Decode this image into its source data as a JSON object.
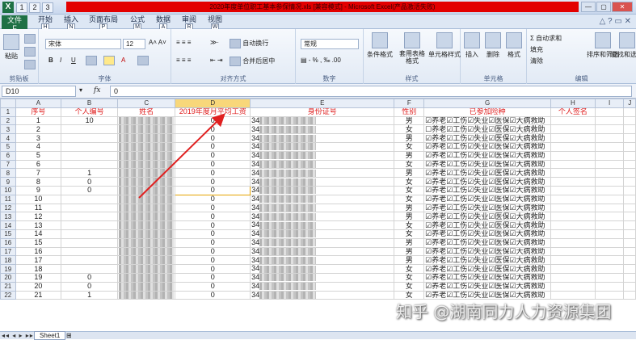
{
  "window": {
    "title": "2020年度单位职工基本参保情况.xls [兼容模式] - Microsoft Excel(产品激活失败)",
    "quick_access_keys": [
      "1",
      "2",
      "3"
    ],
    "buttons": [
      "—",
      "▢",
      "✕"
    ]
  },
  "ribbon_tabs": [
    {
      "label": "文件",
      "key": "F"
    },
    {
      "label": "开始",
      "key": "H"
    },
    {
      "label": "插入",
      "key": "N"
    },
    {
      "label": "页面布局",
      "key": "P"
    },
    {
      "label": "公式",
      "key": "M"
    },
    {
      "label": "数据",
      "key": "A"
    },
    {
      "label": "审阅",
      "key": "R"
    },
    {
      "label": "视图",
      "key": "W"
    }
  ],
  "ribbon": {
    "clipboard": {
      "paste": "粘贴",
      "label": "剪贴板"
    },
    "font": {
      "name": "宋体",
      "size": "12",
      "bold": "B",
      "italic": "I",
      "underline": "U",
      "label": "字体"
    },
    "alignment": {
      "wrap": "自动换行",
      "merge": "合并后居中",
      "label": "对齐方式"
    },
    "number": {
      "format": "常规",
      "label": "数字"
    },
    "styles": {
      "conditional": "条件格式",
      "table": "套用表格格式",
      "cell": "单元格样式",
      "label": "样式"
    },
    "cells": {
      "insert": "插入",
      "delete": "删除",
      "format": "格式",
      "label": "单元格"
    },
    "editing": {
      "autosum": "Σ 自动求和",
      "fill": "填充",
      "clear": "清除",
      "sort": "排序和筛选",
      "find": "查找和选择",
      "label": "编辑"
    }
  },
  "formula_bar": {
    "name_box": "D10",
    "fx": "fx",
    "value": "0"
  },
  "columns": [
    "A",
    "B",
    "C",
    "D",
    "E",
    "F",
    "G",
    "H",
    "I",
    "J"
  ],
  "header_row": [
    "序号",
    "个人编号",
    "姓名",
    "2019年度月平均工资",
    "身份证号",
    "性别",
    "已参加险种",
    "个人签名",
    "",
    ""
  ],
  "rows": [
    {
      "n": "2",
      "seq": "1",
      "id": "10",
      "wage": "0",
      "idno": "34",
      "sex": "男",
      "ins": "☑养老☑工伤☑失业☑医保☑大病救助"
    },
    {
      "n": "3",
      "seq": "2",
      "id": "",
      "wage": "0",
      "idno": "34",
      "sex": "女",
      "ins": "☐养老☑工伤☑失业☑医保☑大病救助"
    },
    {
      "n": "4",
      "seq": "3",
      "id": "",
      "wage": "0",
      "idno": "34",
      "sex": "男",
      "ins": "☑养老☑工伤☑失业☑医保☑大病救助"
    },
    {
      "n": "5",
      "seq": "4",
      "id": "",
      "wage": "0",
      "idno": "34",
      "sex": "女",
      "ins": "☑养老☑工伤☑失业☑医保☑大病救助"
    },
    {
      "n": "6",
      "seq": "5",
      "id": "",
      "wage": "0",
      "idno": "34",
      "sex": "男",
      "ins": "☑养老☑工伤☑失业☑医保☑大病救助"
    },
    {
      "n": "7",
      "seq": "6",
      "id": "",
      "wage": "0",
      "idno": "34",
      "sex": "女",
      "ins": "☑养老☑工伤☑失业☑医保☑大病救助"
    },
    {
      "n": "8",
      "seq": "7",
      "id": "1",
      "wage": "0",
      "idno": "34",
      "sex": "男",
      "ins": "☑养老☑工伤☑失业☑医保☑大病救助"
    },
    {
      "n": "9",
      "seq": "8",
      "id": "0",
      "wage": "0",
      "idno": "34",
      "sex": "女",
      "ins": "☑养老☑工伤☑失业☑医保☑大病救助"
    },
    {
      "n": "10",
      "seq": "9",
      "id": "0",
      "wage": "0",
      "idno": "34",
      "sex": "女",
      "ins": "☑养老☑工伤☑失业☑医保☑大病救助"
    },
    {
      "n": "11",
      "seq": "10",
      "id": "",
      "wage": "0",
      "idno": "34",
      "sex": "女",
      "ins": "☑养老☑工伤☑失业☑医保☑大病救助"
    },
    {
      "n": "12",
      "seq": "11",
      "id": "",
      "wage": "0",
      "idno": "34",
      "sex": "男",
      "ins": "☑养老☑工伤☑失业☑医保☑大病救助"
    },
    {
      "n": "13",
      "seq": "12",
      "id": "",
      "wage": "0",
      "idno": "34",
      "sex": "男",
      "ins": "☑养老☑工伤☑失业☑医保☑大病救助"
    },
    {
      "n": "14",
      "seq": "13",
      "id": "",
      "wage": "0",
      "idno": "34",
      "sex": "女",
      "ins": "☑养老☑工伤☑失业☑医保☑大病救助"
    },
    {
      "n": "15",
      "seq": "14",
      "id": "",
      "wage": "0",
      "idno": "34",
      "sex": "女",
      "ins": "☑养老☑工伤☑失业☑医保☑大病救助"
    },
    {
      "n": "16",
      "seq": "15",
      "id": "",
      "wage": "0",
      "idno": "34",
      "sex": "男",
      "ins": "☑养老☑工伤☑失业☑医保☑大病救助"
    },
    {
      "n": "17",
      "seq": "16",
      "id": "",
      "wage": "0",
      "idno": "34",
      "sex": "男",
      "ins": "☑养老☑工伤☑失业☑医保☑大病救助"
    },
    {
      "n": "18",
      "seq": "17",
      "id": "",
      "wage": "0",
      "idno": "34",
      "sex": "男",
      "ins": "☑养老☑工伤☑失业☑医保☑大病救助"
    },
    {
      "n": "19",
      "seq": "18",
      "id": "",
      "wage": "0",
      "idno": "34",
      "sex": "女",
      "ins": "☑养老☑工伤☑失业☑医保☑大病救助"
    },
    {
      "n": "20",
      "seq": "19",
      "id": "0",
      "wage": "0",
      "idno": "34",
      "sex": "女",
      "ins": "☑养老☑工伤☑失业☑医保☑大病救助"
    },
    {
      "n": "21",
      "seq": "20",
      "id": "0",
      "wage": "0",
      "idno": "34",
      "sex": "女",
      "ins": "☑养老☑工伤☑失业☑医保☑大病救助"
    },
    {
      "n": "22",
      "seq": "21",
      "id": "1",
      "wage": "0",
      "idno": "34",
      "sex": "女",
      "ins": "☑养老☑工伤☑失业☑医保☑大病救助"
    }
  ],
  "sheet_tab": "Sheet1",
  "watermark": "知乎 @湖南同力人力资源集团",
  "colors": {
    "excel_green": "#1e7145",
    "header_red": "#e02020",
    "annotation_red": "#e02020"
  }
}
